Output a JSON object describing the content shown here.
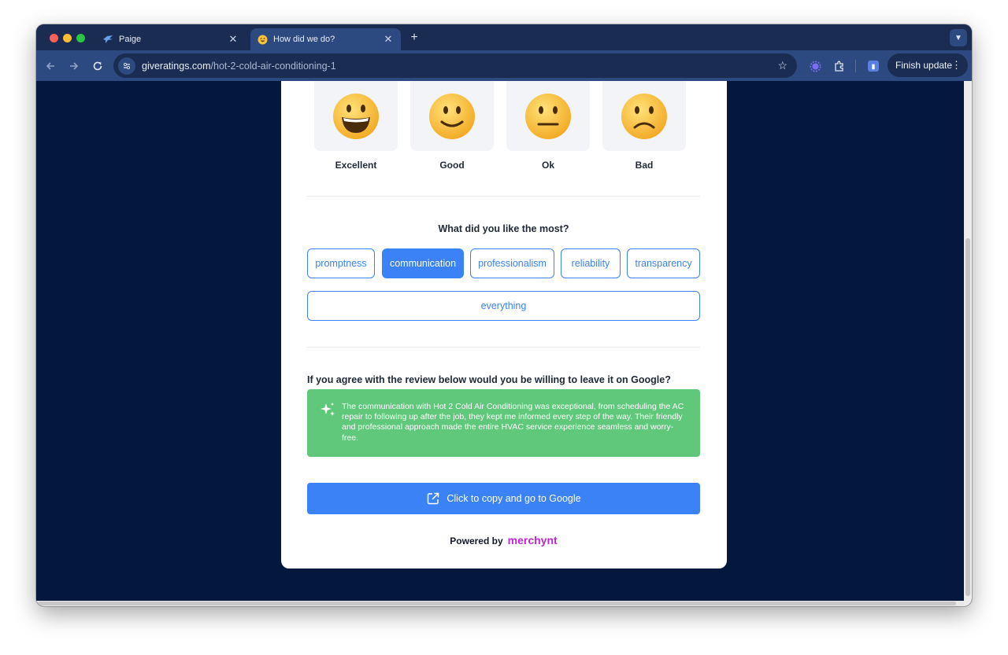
{
  "browser": {
    "tabs": [
      {
        "title": "Paige",
        "favicon": "paige-logo-icon"
      },
      {
        "title": "How did we do?",
        "favicon": "grinning-emoji-icon"
      }
    ],
    "new_tab_label": "+",
    "address": {
      "domain": "giveratings.com",
      "path": "/hot-2-cold-air-conditioning-1"
    },
    "finish_update_label": "Finish update"
  },
  "ratings": [
    {
      "label": "Excellent",
      "emoji": "grinning-face"
    },
    {
      "label": "Good",
      "emoji": "smiling-face"
    },
    {
      "label": "Ok",
      "emoji": "neutral-face"
    },
    {
      "label": "Bad",
      "emoji": "frowning-face"
    }
  ],
  "likes": {
    "question": "What did you like the most?",
    "chips": [
      {
        "label": "promptness",
        "selected": false
      },
      {
        "label": "communication",
        "selected": true
      },
      {
        "label": "professionalism",
        "selected": false
      },
      {
        "label": "reliability",
        "selected": false
      },
      {
        "label": "transparency",
        "selected": false
      },
      {
        "label": "everything",
        "selected": false
      }
    ]
  },
  "review": {
    "question": "If you agree with the review below would you be willing to leave it on Google?",
    "text": "The communication with Hot 2 Cold Air Conditioning was exceptional, from scheduling the AC repair to following up after the job, they kept me informed every step of the way. Their friendly and professional approach made the entire HVAC service experience seamless and worry-free."
  },
  "google_button_label": "Click to copy and go to Google",
  "footer": {
    "powered_by": "Powered by",
    "brand": "merchynt"
  },
  "colors": {
    "accent": "#3b82f6",
    "review_bg": "#5fc87a",
    "page_bg": "#04183e",
    "brand": "#c026d3"
  }
}
